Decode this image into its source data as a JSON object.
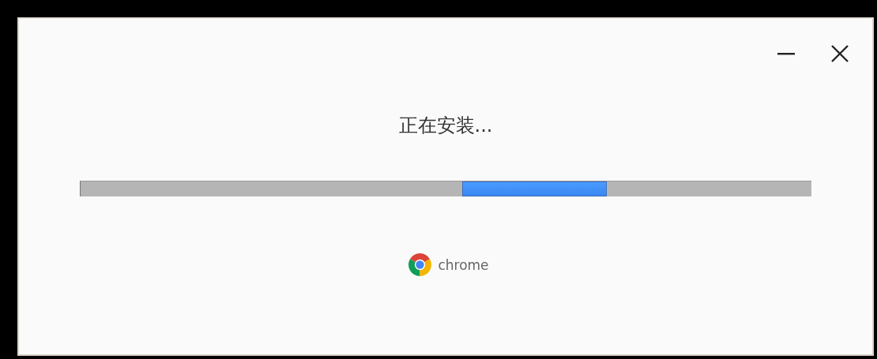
{
  "window": {
    "controls": [
      {
        "kind": "minimize"
      },
      {
        "kind": "close"
      }
    ]
  },
  "status": "正在安装...",
  "progress": {
    "indeterminate": true
  },
  "brand": {
    "name": "chrome"
  }
}
